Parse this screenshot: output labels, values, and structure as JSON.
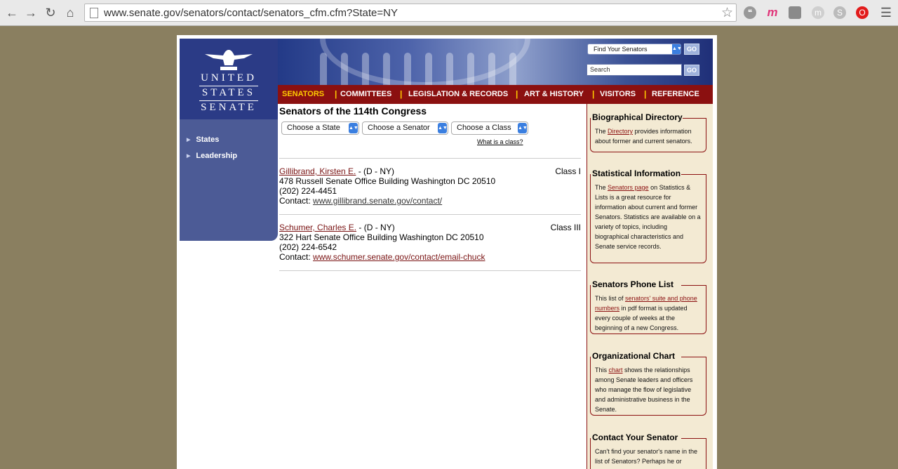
{
  "browser": {
    "url": "www.senate.gov/senators/contact/senators_cfm.cfm?State=NY"
  },
  "header": {
    "logo_line1": "UNITED",
    "logo_line2": "STATES",
    "logo_line3": "SENATE",
    "find_senators_label": "Find Your Senators",
    "go_label": "GO",
    "search_placeholder": "Search"
  },
  "topnav": {
    "items": [
      {
        "label": "SENATORS"
      },
      {
        "label": "COMMITTEES"
      },
      {
        "label": "LEGISLATION & RECORDS"
      },
      {
        "label": "ART & HISTORY"
      },
      {
        "label": "VISITORS"
      },
      {
        "label": "REFERENCE"
      }
    ],
    "separator": "|"
  },
  "leftnav": {
    "items": [
      {
        "label": "States"
      },
      {
        "label": "Leadership"
      }
    ]
  },
  "main": {
    "title": "Senators of the 114th Congress",
    "dropdowns": [
      {
        "label": "Choose a State"
      },
      {
        "label": "Choose a Senator"
      },
      {
        "label": "Choose a Class"
      }
    ],
    "what_is_class": "What is a class?",
    "senators": [
      {
        "name": "Gillibrand, Kirsten E.",
        "party": " - (D - NY)",
        "class": "Class I",
        "address": "478 Russell Senate Office Building Washington DC 20510",
        "phone": "(202) 224-4451",
        "contact_label": "Contact: ",
        "contact_url": "www.gillibrand.senate.gov/contact/"
      },
      {
        "name": "Schumer, Charles E.",
        "party": " - (D - NY)",
        "class": "Class III",
        "address": "322 Hart Senate Office Building Washington DC 20510",
        "phone": "(202) 224-6542",
        "contact_label": "Contact: ",
        "contact_url": "www.schumer.senate.gov/contact/email-chuck"
      }
    ]
  },
  "sidebar": {
    "bio": {
      "title": "Biographical Directory",
      "pre": "The ",
      "link": "Directory",
      "post": " provides information about former and current senators."
    },
    "stats": {
      "title": "Statistical Information",
      "pre": "The ",
      "link": "Senators page",
      "post": " on Statistics & Lists is a great resource for information about current and former Senators. Statistics are available on a variety of topics, including biographical characteristics and Senate service records."
    },
    "phone": {
      "title": "Senators Phone List",
      "pre": "This list of ",
      "link": "senators' suite and phone numbers",
      "post": " in pdf format is updated every couple of weeks at the beginning of a new Congress."
    },
    "org": {
      "title": "Organizational Chart",
      "pre": "This ",
      "link": "chart",
      "post": " shows the relationships among Senate leaders and officers who manage the flow of legislative and administrative business in the Senate."
    },
    "contact": {
      "title": "Contact Your Senator",
      "text": "Can't find your senator's name in the list of Senators?  Perhaps he or"
    }
  }
}
